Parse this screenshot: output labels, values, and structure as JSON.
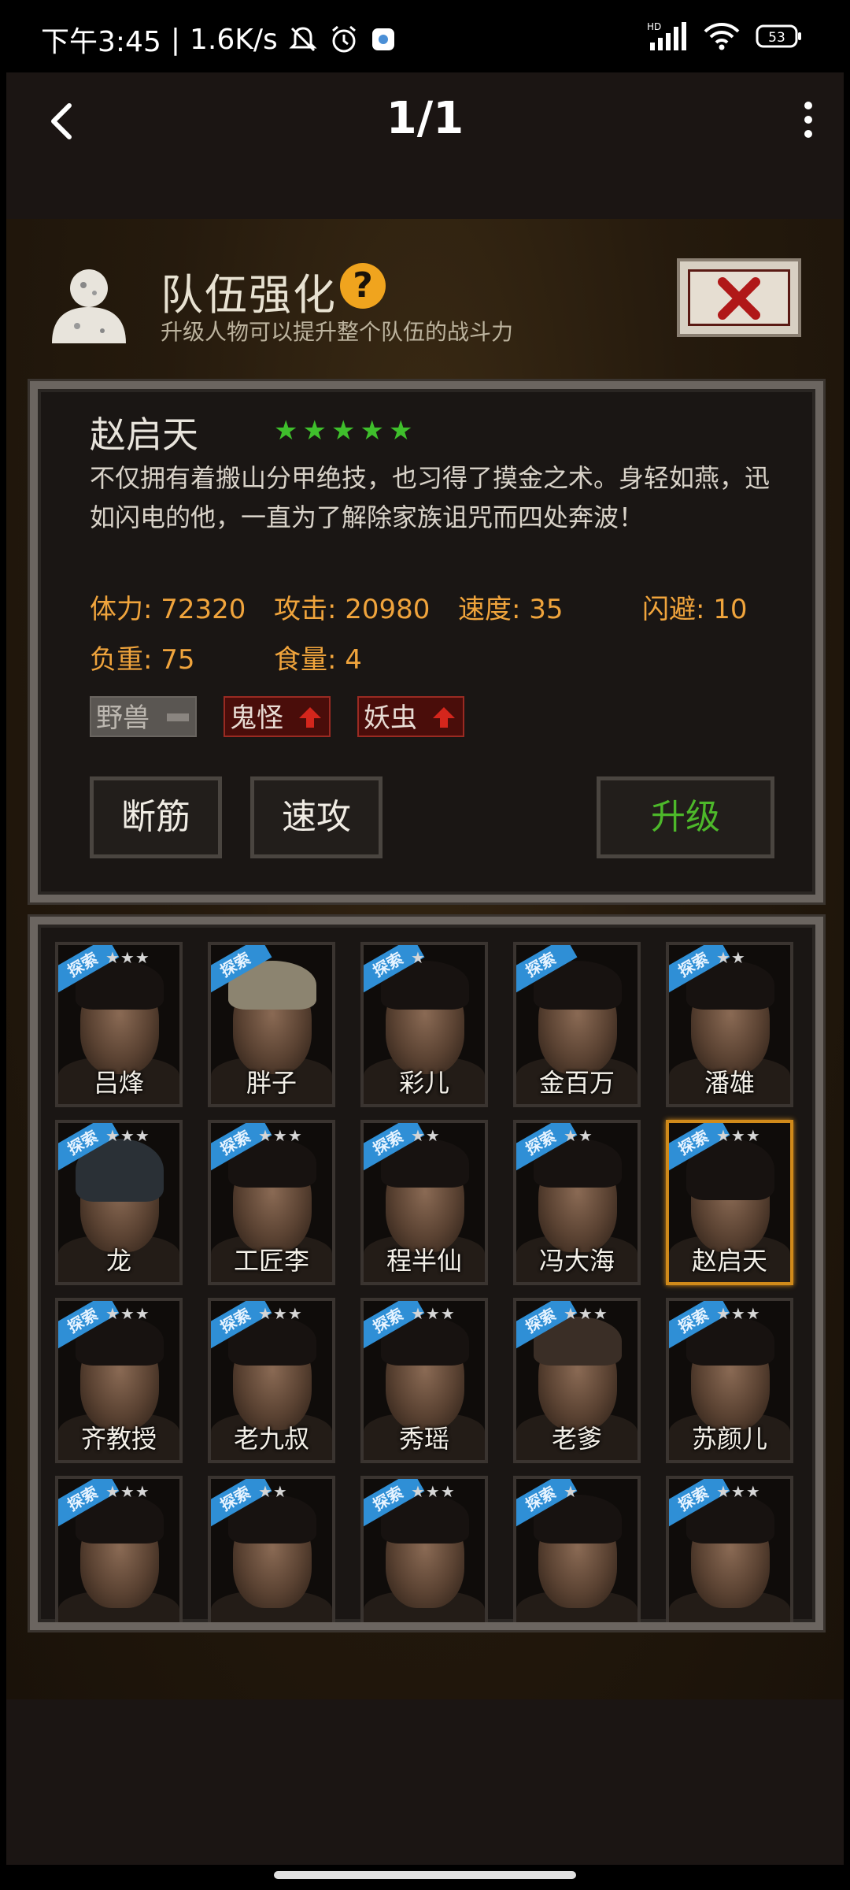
{
  "status_bar": {
    "time": "下午3:45",
    "speed": "1.6K/s",
    "network": "HD",
    "battery": "53"
  },
  "viewer": {
    "page_indicator": "1/1"
  },
  "game": {
    "title": "队伍强化",
    "help_symbol": "?",
    "subtitle": "升级人物可以提升整个队伍的战斗力",
    "character": {
      "name": "赵启天",
      "stars": 5,
      "description": "不仅拥有着搬山分甲绝技，也习得了摸金之术。身轻如燕，迅如闪电的他，一直为了解除家族诅咒而四处奔波！",
      "stats": [
        {
          "label": "体力: 72320"
        },
        {
          "label": "攻击: 20980"
        },
        {
          "label": "速度: 35"
        },
        {
          "label": "闪避: 10"
        },
        {
          "label": "负重: 75"
        },
        {
          "label": "食量: 4"
        }
      ],
      "tags": [
        {
          "label": "野兽",
          "state": "neutral"
        },
        {
          "label": "鬼怪",
          "state": "up"
        },
        {
          "label": "妖虫",
          "state": "up"
        }
      ],
      "skills": [
        "断筋",
        "速攻"
      ],
      "upgrade_label": "升级"
    },
    "roster": {
      "badge_label": "探索",
      "members": [
        {
          "name": "吕烽",
          "stars": "★★★"
        },
        {
          "name": "胖子",
          "stars": ""
        },
        {
          "name": "彩儿",
          "stars": "★"
        },
        {
          "name": "金百万",
          "stars": ""
        },
        {
          "name": "潘雄",
          "stars": "★★"
        },
        {
          "name": "龙",
          "stars": "★★★"
        },
        {
          "name": "工匠李",
          "stars": "★★★"
        },
        {
          "name": "程半仙",
          "stars": "★★"
        },
        {
          "name": "冯大海",
          "stars": "★★"
        },
        {
          "name": "赵启天",
          "stars": "★★★",
          "selected": true
        },
        {
          "name": "齐教授",
          "stars": "★★★"
        },
        {
          "name": "老九叔",
          "stars": "★★★"
        },
        {
          "name": "秀瑶",
          "stars": "★★★"
        },
        {
          "name": "老爹",
          "stars": "★★★"
        },
        {
          "name": "苏颜儿",
          "stars": "★★★"
        },
        {
          "name": "",
          "stars": "★★★"
        },
        {
          "name": "",
          "stars": "★★"
        },
        {
          "name": "",
          "stars": "★★★"
        },
        {
          "name": "",
          "stars": "★"
        },
        {
          "name": "",
          "stars": "★★★"
        }
      ]
    }
  }
}
